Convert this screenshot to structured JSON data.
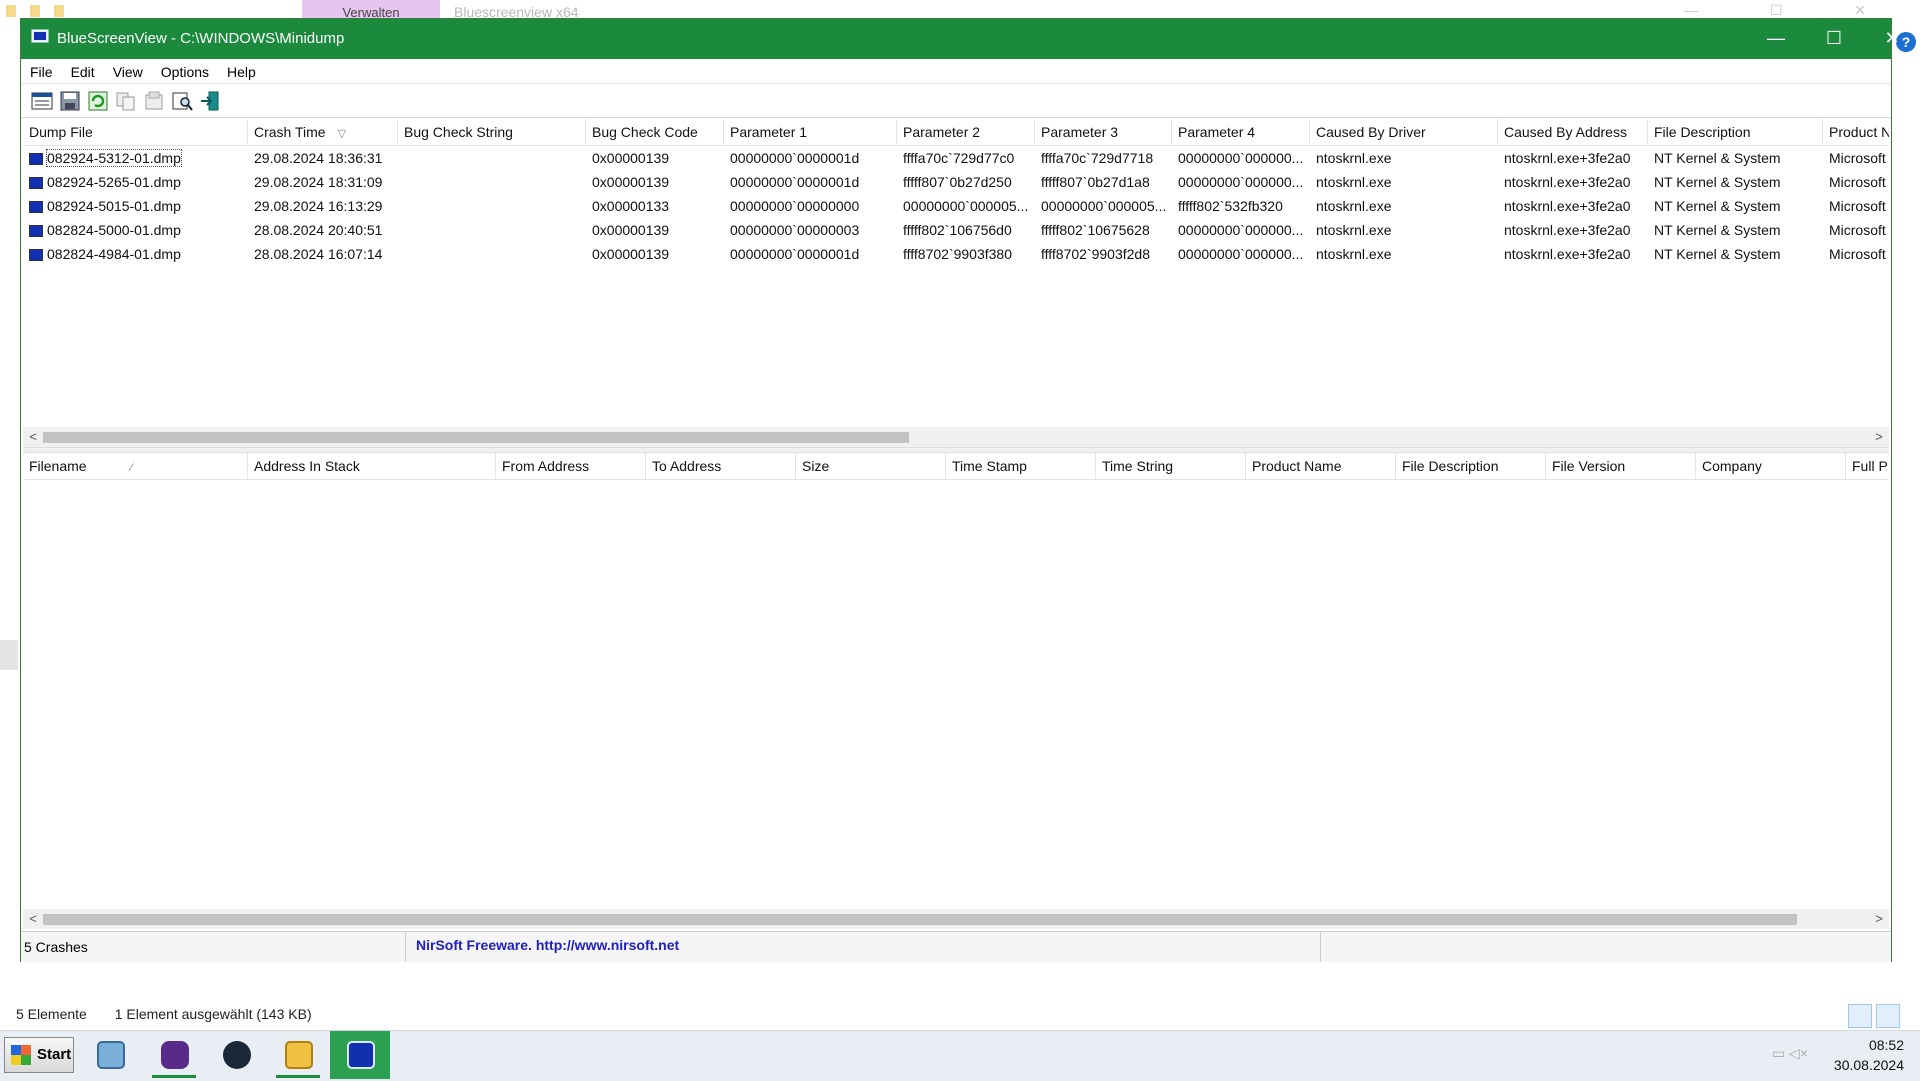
{
  "background": {
    "tab_label": "Verwalten",
    "title": "Bluescreenview x64",
    "status_items": "5 Elemente",
    "status_selected": "1 Element ausgewählt (143 KB)"
  },
  "window": {
    "title": "BlueScreenView  -  C:\\WINDOWS\\Minidump",
    "minimize_glyph": "—",
    "maximize_glyph": "☐",
    "close_glyph": "✕"
  },
  "menu": [
    "File",
    "Edit",
    "View",
    "Options",
    "Help"
  ],
  "toolbar_icons": [
    "properties-icon",
    "save-icon",
    "refresh-icon",
    "copy-icon",
    "export-icon",
    "find-icon",
    "exit-icon"
  ],
  "crash_table": {
    "columns": [
      "Dump File",
      "Crash Time",
      "Bug Check String",
      "Bug Check Code",
      "Parameter 1",
      "Parameter 2",
      "Parameter 3",
      "Parameter 4",
      "Caused By Driver",
      "Caused By Address",
      "File Description",
      "Product N"
    ],
    "sort_glyph": "▽",
    "rows": [
      [
        "082924-5312-01.dmp",
        "29.08.2024 18:36:31",
        "",
        "0x00000139",
        "00000000`0000001d",
        "ffffa70c`729d77c0",
        "ffffa70c`729d7718",
        "00000000`000000...",
        "ntoskrnl.exe",
        "ntoskrnl.exe+3fe2a0",
        "NT Kernel & System",
        "Microsoft"
      ],
      [
        "082924-5265-01.dmp",
        "29.08.2024 18:31:09",
        "",
        "0x00000139",
        "00000000`0000001d",
        "fffff807`0b27d250",
        "fffff807`0b27d1a8",
        "00000000`000000...",
        "ntoskrnl.exe",
        "ntoskrnl.exe+3fe2a0",
        "NT Kernel & System",
        "Microsoft"
      ],
      [
        "082924-5015-01.dmp",
        "29.08.2024 16:13:29",
        "",
        "0x00000133",
        "00000000`00000000",
        "00000000`000005...",
        "00000000`000005...",
        "fffff802`532fb320",
        "ntoskrnl.exe",
        "ntoskrnl.exe+3fe2a0",
        "NT Kernel & System",
        "Microsoft"
      ],
      [
        "082824-5000-01.dmp",
        "28.08.2024 20:40:51",
        "",
        "0x00000139",
        "00000000`00000003",
        "fffff802`106756d0",
        "fffff802`10675628",
        "00000000`000000...",
        "ntoskrnl.exe",
        "ntoskrnl.exe+3fe2a0",
        "NT Kernel & System",
        "Microsoft"
      ],
      [
        "082824-4984-01.dmp",
        "28.08.2024 16:07:14",
        "",
        "0x00000139",
        "00000000`0000001d",
        "ffff8702`9903f380",
        "ffff8702`9903f2d8",
        "00000000`000000...",
        "ntoskrnl.exe",
        "ntoskrnl.exe+3fe2a0",
        "NT Kernel & System",
        "Microsoft"
      ]
    ]
  },
  "driver_table": {
    "columns": [
      "Filename",
      "Address In Stack",
      "From Address",
      "To Address",
      "Size",
      "Time Stamp",
      "Time String",
      "Product Name",
      "File Description",
      "File Version",
      "Company",
      "Full P"
    ],
    "sort_glyph": "∕",
    "rows": []
  },
  "scroll_left": "<",
  "scroll_right": ">",
  "status": {
    "crashes": "5 Crashes",
    "nirsoft": "NirSoft Freeware.  http://www.nirsoft.net"
  },
  "taskbar": {
    "start_label": "Start",
    "time": "08:52",
    "date": "30.08.2024",
    "apps": [
      "notes-app-icon",
      "brave-browser-icon",
      "steam-icon",
      "file-explorer-icon",
      "bluescreenview-icon"
    ]
  },
  "colors": {
    "titlebar": "#1b8a3c",
    "link": "#2020c0"
  }
}
